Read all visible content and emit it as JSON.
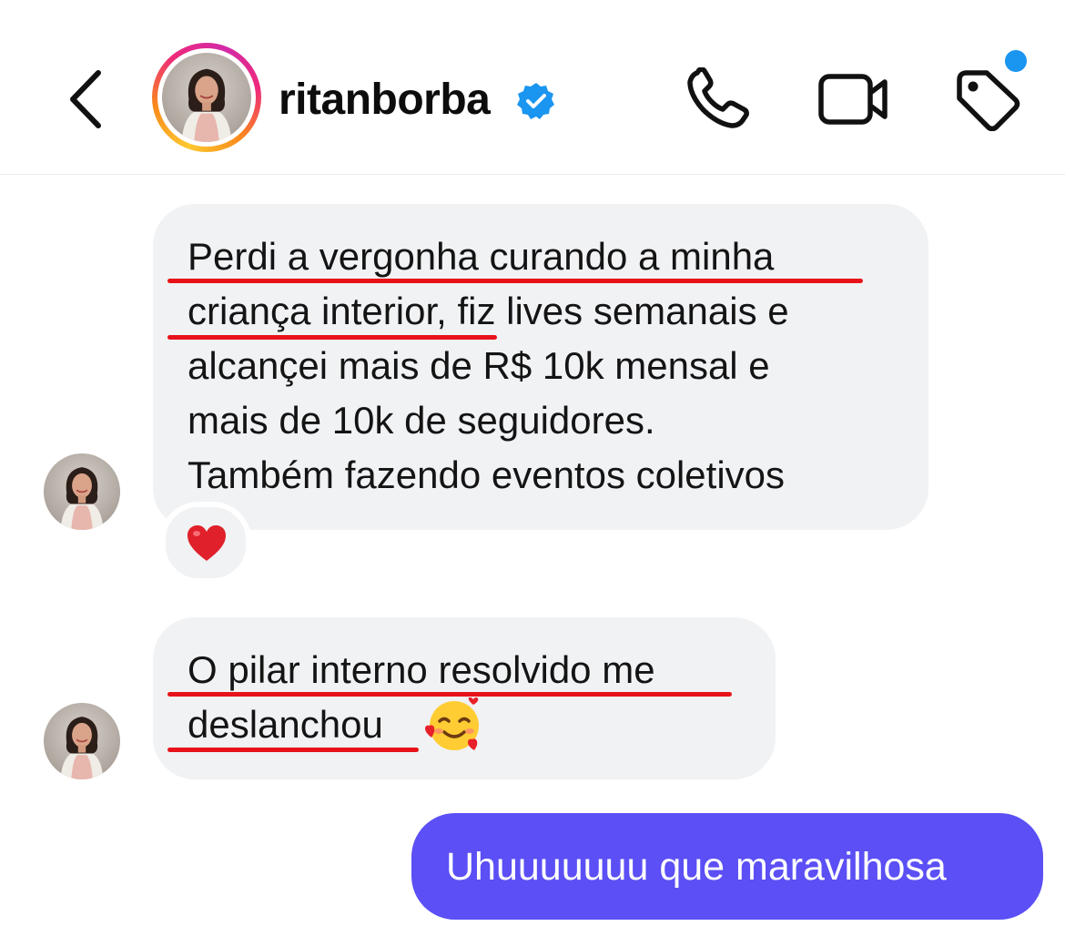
{
  "header": {
    "username": "ritanborba",
    "verified": true,
    "has_notification": true
  },
  "colors": {
    "outgoing_bubble": "#5b4ff5",
    "incoming_bubble": "#f1f2f4",
    "underline": "#e8131a",
    "verified_badge": "#1a95f0",
    "notification_dot": "#1a95f0"
  },
  "icons": {
    "back": "chevron-left-icon",
    "call": "phone-icon",
    "video": "video-camera-icon",
    "tag": "tag-icon",
    "verified": "verified-badge-icon"
  },
  "messages": [
    {
      "direction": "incoming",
      "lines": [
        "Perdi a vergonha curando a minha",
        "criança interior, fiz lives semanais e",
        "alcançei mais de R$ 10k mensal e",
        "mais de 10k de seguidores.",
        "Também fazendo eventos coletivos"
      ],
      "reaction": "red-heart-emoji"
    },
    {
      "direction": "incoming",
      "lines": [
        "O pilar interno resolvido me",
        "deslanchou"
      ],
      "trailing_emoji": "smiling-face-with-hearts-emoji"
    },
    {
      "direction": "outgoing",
      "text": "Uhuuuuuuu que maravilhosa"
    }
  ]
}
